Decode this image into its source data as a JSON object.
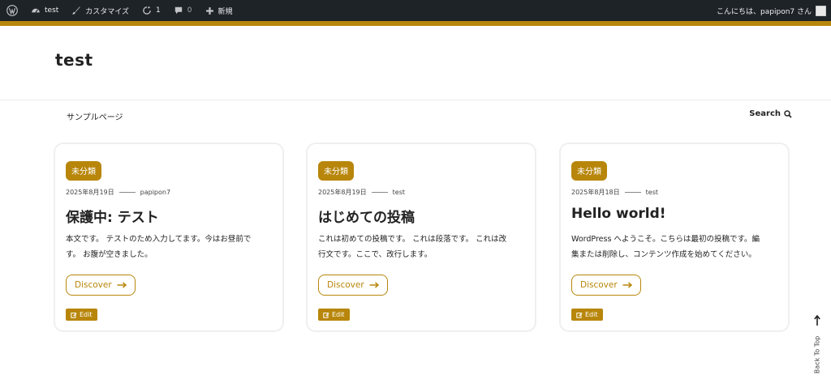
{
  "adminbar": {
    "site_name": "test",
    "customize_label": "カスタマイズ",
    "updates_count": "1",
    "comments_count": "0",
    "new_label": "新規",
    "greeting": "こんにちは、papipon7 さん"
  },
  "site": {
    "title": "test"
  },
  "nav": {
    "sample_page": "サンプルページ",
    "search_label": "Search"
  },
  "posts": [
    {
      "category": "未分類",
      "date": "2025年8月19日",
      "author": "papipon7",
      "title": "保護中: テスト",
      "excerpt_line1": "本文です。 テストのため入力してます。今はお昼前で",
      "excerpt_line2": "す。 お腹が空きました。",
      "discover_label": "Discover",
      "edit_label": "Edit"
    },
    {
      "category": "未分類",
      "date": "2025年8月19日",
      "author": "test",
      "title": "はじめての投稿",
      "excerpt_line1": "これは初めての投稿です。 これは段落です。 これは改",
      "excerpt_line2": "行文です。ここで、改行します。",
      "discover_label": "Discover",
      "edit_label": "Edit"
    },
    {
      "category": "未分類",
      "date": "2025年8月18日",
      "author": "test",
      "title": "Hello world!",
      "excerpt_line1": "WordPress へようこそ。こちらは最初の投稿です。編",
      "excerpt_line2": "集または削除し、コンテンツ作成を始めてください。",
      "discover_label": "Discover",
      "edit_label": "Edit"
    }
  ],
  "back_to_top": "Back To Top",
  "colors": {
    "accent": "#b8860b",
    "adminbar": "#1d2327"
  },
  "icons": [
    "wordpress-logo-icon",
    "dashboard-icon",
    "brush-icon",
    "update-icon",
    "comment-icon",
    "plus-icon",
    "avatar-icon",
    "search-icon",
    "arrow-right-icon",
    "edit-icon",
    "arrow-up-icon"
  ]
}
